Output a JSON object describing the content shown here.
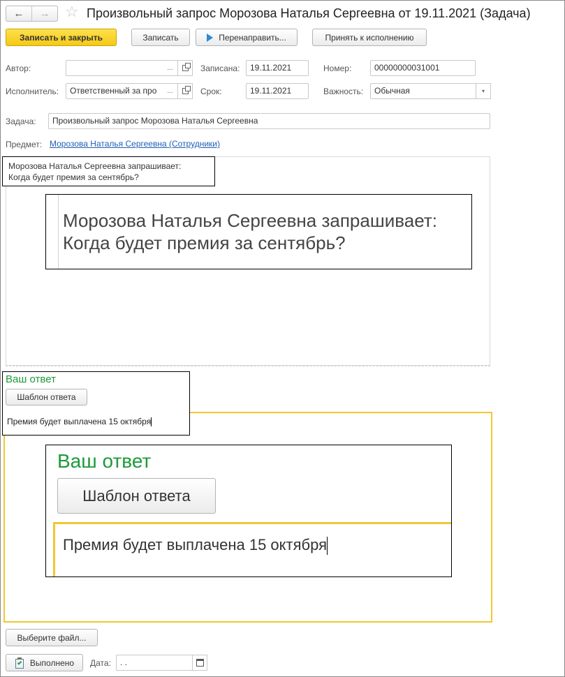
{
  "window": {
    "title": "Произвольный запрос Морозова Наталья Сергеевна от 19.11.2021 (Задача)"
  },
  "toolbar": {
    "save_close": "Записать и закрыть",
    "save": "Записать",
    "redirect": "Перенаправить...",
    "accept": "Принять к исполнению"
  },
  "form": {
    "author_label": "Автор:",
    "author_value": "",
    "author_select": "...",
    "recorded_label": "Записана:",
    "recorded_value": "19.11.2021",
    "number_label": "Номер:",
    "number_value": "00000000031001",
    "executor_label": "Исполнитель:",
    "executor_value": "Ответственный за про",
    "executor_select": "...",
    "deadline_label": "Срок:",
    "deadline_value": "19.11.2021",
    "importance_label": "Важность:",
    "importance_value": "Обычная",
    "task_label": "Задача:",
    "task_value": "Произвольный запрос Морозова Наталья Сергеевна",
    "subject_label": "Предмет:",
    "subject_link": "Морозова Наталья Сергеевна (Сотрудники)"
  },
  "request": {
    "line1": "Морозова Наталья Сергеевна запрашивает:",
    "line2": "Когда будет премия за сентябрь?"
  },
  "answer": {
    "heading": "Ваш ответ",
    "template_button": "Шаблон ответа",
    "text": "Премия будет выплачена 15 октября"
  },
  "footer": {
    "choose_file": "Выберите файл...",
    "done_button": "Выполнено",
    "date_label": "Дата:",
    "date_value": " .  ."
  },
  "colors": {
    "primary_button": "#f4c817",
    "answer_border": "#f0c832",
    "answer_heading": "#1d9a3a",
    "link": "#1f5fb4"
  }
}
